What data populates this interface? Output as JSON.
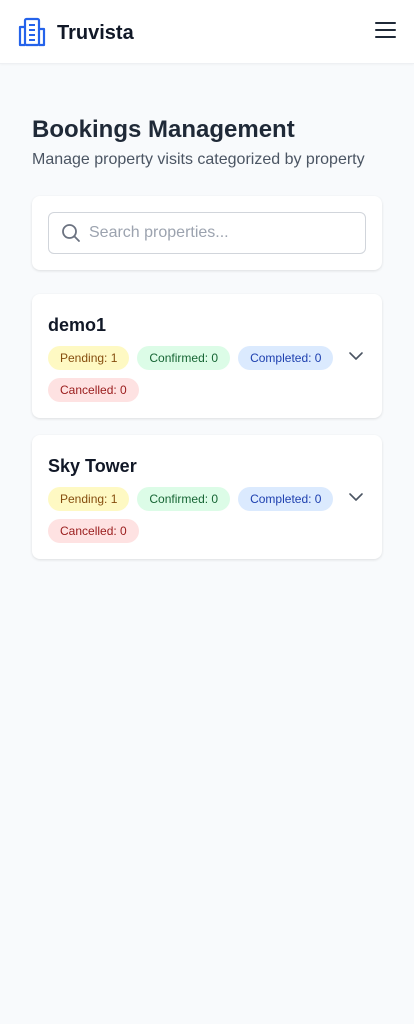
{
  "app": {
    "name": "Truvista"
  },
  "header": {
    "menu_icon": "hamburger-menu-icon",
    "logo_icon": "building-icon"
  },
  "page": {
    "title": "Bookings Management",
    "subtitle": "Manage property visits categorized by property"
  },
  "search": {
    "placeholder": "Search properties...",
    "value": ""
  },
  "properties": [
    {
      "name": "demo1",
      "pending": "Pending: 1",
      "confirmed": "Confirmed: 0",
      "completed": "Completed: 0",
      "cancelled": "Cancelled: 0"
    },
    {
      "name": "Sky Tower",
      "pending": "Pending: 1",
      "confirmed": "Confirmed: 0",
      "completed": "Completed: 0",
      "cancelled": "Cancelled: 0"
    }
  ],
  "colors": {
    "brand": "#2563eb",
    "pending_bg": "#fef9c3",
    "confirmed_bg": "#dcfce7",
    "completed_bg": "#dbeafe",
    "cancelled_bg": "#fee2e2"
  }
}
